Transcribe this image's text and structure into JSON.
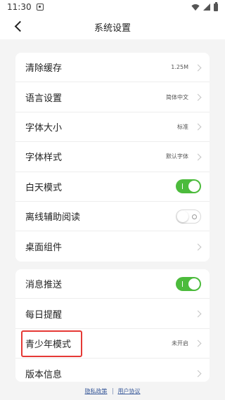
{
  "status_bar": {
    "time": "11:30"
  },
  "nav": {
    "title": "系统设置"
  },
  "settings_group_1": [
    {
      "label": "清除缓存",
      "value": "1.25M"
    },
    {
      "label": "语言设置",
      "value": "简体中文"
    },
    {
      "label": "字体大小",
      "value": "标准"
    },
    {
      "label": "字体样式",
      "value": "默认字体"
    },
    {
      "label": "白天模式",
      "toggle": "on"
    },
    {
      "label": "离线辅助阅读",
      "toggle": "off"
    },
    {
      "label": "桌面组件"
    }
  ],
  "settings_group_2": [
    {
      "label": "消息推送",
      "toggle": "on"
    },
    {
      "label": "每日提醒"
    },
    {
      "label": "青少年模式",
      "value": "未开启"
    },
    {
      "label": "版本信息"
    }
  ],
  "footer": {
    "privacy_policy": "隐私政策",
    "user_agreement": "用户协议"
  },
  "colors": {
    "toggle_on": "#4cbb3c",
    "highlight": "#e53935",
    "link": "#3a5a9a"
  }
}
